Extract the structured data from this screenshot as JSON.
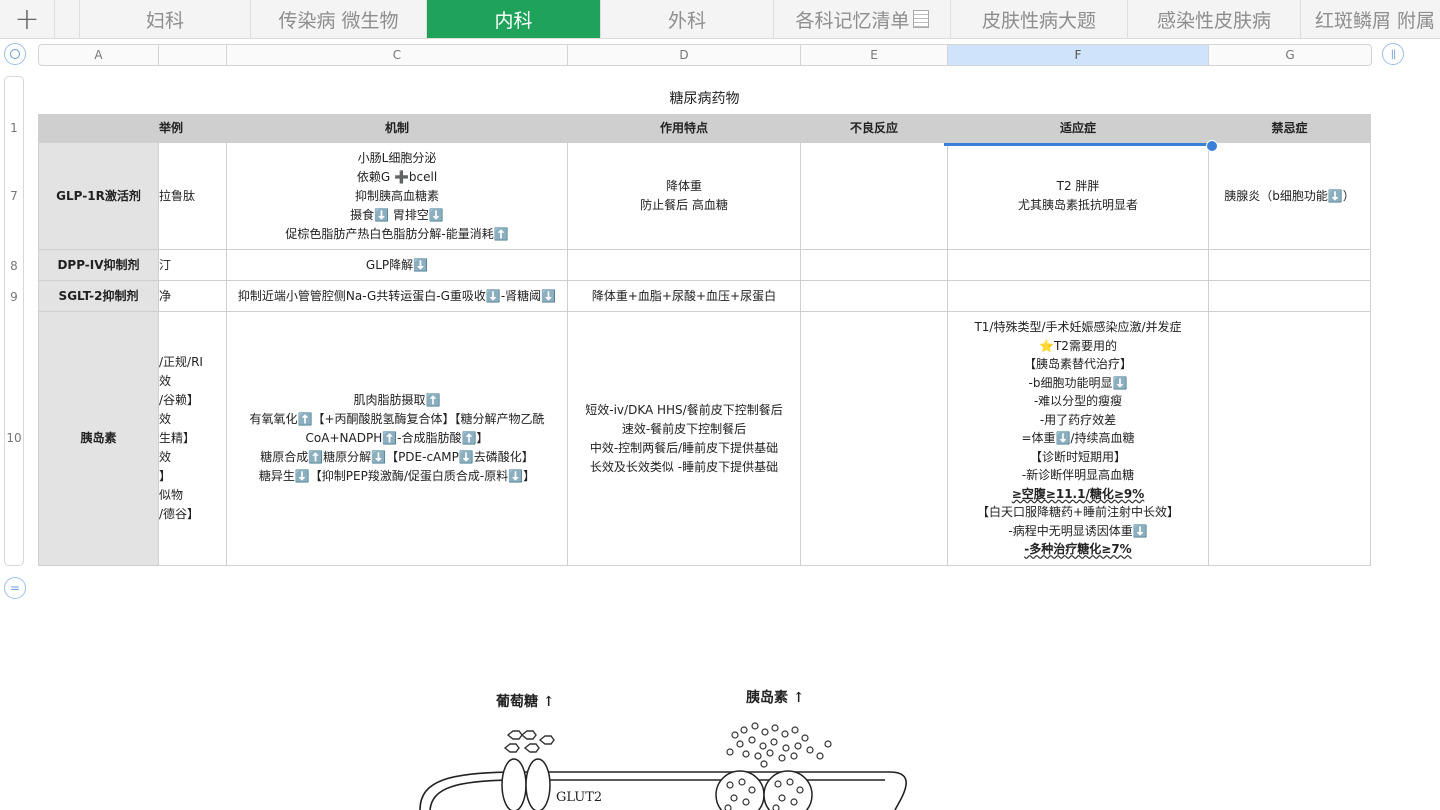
{
  "tabs": [
    {
      "label": "妇科",
      "active": false
    },
    {
      "label": "传染病 微生物",
      "active": false
    },
    {
      "label": "内科",
      "active": true
    },
    {
      "label": "外科",
      "active": false
    },
    {
      "label": "各科记忆清单",
      "active": false
    },
    {
      "label": "皮肤性病大题",
      "active": false
    },
    {
      "label": "感染性皮肤病",
      "active": false
    },
    {
      "label": "红斑鳞屑 附属",
      "active": false
    }
  ],
  "add_tab_icon": "plus-icon",
  "columns": [
    "A",
    "",
    "C",
    "D",
    "E",
    "F",
    "G"
  ],
  "selected_column": "F",
  "row_numbers": [
    "1",
    "7",
    "8",
    "9",
    "10"
  ],
  "sheet_title": "糖尿病药物",
  "header": [
    "",
    "举例",
    "机制",
    "作用特点",
    "不良反应",
    "适应症",
    "禁忌症"
  ],
  "rows": [
    {
      "name": "GLP-1R激活剂",
      "example": [
        "拉鲁肽"
      ],
      "mechanism": [
        "小肠L细胞分泌",
        "依赖G ➕bcell",
        "抑制胰高血糖素",
        "摄食⬇️ 胃排空⬇️",
        "促棕色脂肪产热白色脂肪分解-能量消耗⬆️"
      ],
      "feature": [
        "降体重",
        "防止餐后 高血糖"
      ],
      "adverse": [],
      "indication": [
        "T2 胖胖",
        "尤其胰岛素抵抗明显者"
      ],
      "contra": [
        "胰腺炎（b细胞功能⬇️）"
      ]
    },
    {
      "name": "DPP-IV抑制剂",
      "example": [
        "汀"
      ],
      "mechanism": [
        "GLP降解⬇️"
      ],
      "feature": [],
      "adverse": [],
      "indication": [],
      "contra": []
    },
    {
      "name": "SGLT-2抑制剂",
      "example": [
        "净"
      ],
      "mechanism": [
        "抑制近端小管管腔侧Na-G共转运蛋白-G重吸收⬇️-肾糖阈⬇️"
      ],
      "feature": [
        "降体重+血脂+尿酸+血压+尿蛋白"
      ],
      "adverse": [],
      "indication": [],
      "contra": []
    },
    {
      "name": "胰岛素",
      "example": [
        "/正规/RI",
        "效",
        "/谷赖】",
        "效",
        "生精】",
        "效",
        "】",
        "似物",
        "/德谷】"
      ],
      "mechanism": [
        "肌肉脂肪摄取⬆️",
        "有氧氧化⬆️【+丙酮酸脱氢酶复合体】【糖分解产物乙酰",
        "CoA+NADPH⬆️-合成脂肪酸⬆️】",
        "糖原合成⬆️糖原分解⬇️【PDE-cAMP⬇️去磷酸化】",
        "糖异生⬇️【抑制PEP羧激酶/促蛋白质合成-原料⬇️】"
      ],
      "feature": [
        "短效-iv/DKA HHS/餐前皮下控制餐后",
        "速效-餐前皮下控制餐后",
        "中效-控制两餐后/睡前皮下提供基础",
        "长效及长效类似 -睡前皮下提供基础"
      ],
      "adverse": [],
      "indication": [
        "T1/特殊类型/手术妊娠感染应激/并发症",
        "⭐T2需要用的",
        "【胰岛素替代治疗】",
        "-b细胞功能明显⬇️",
        "-难以分型的瘦瘦",
        "-用了药疗效差",
        "=体重⬇️/持续高血糖",
        "【诊断时短期用】",
        "-新诊断伴明显高血糖",
        "≥空腹≥11.1/糖化≥9%",
        "【白天口服降糖药+睡前注射中长效】",
        "-病程中无明显诱因体重⬇️",
        "-多种治疗糖化≥7%"
      ],
      "contra": []
    }
  ],
  "diagram": {
    "label_glucose": "葡萄糖 ↑",
    "label_insulin": "胰岛素 ↑",
    "label_glut2": "GLUT2"
  }
}
